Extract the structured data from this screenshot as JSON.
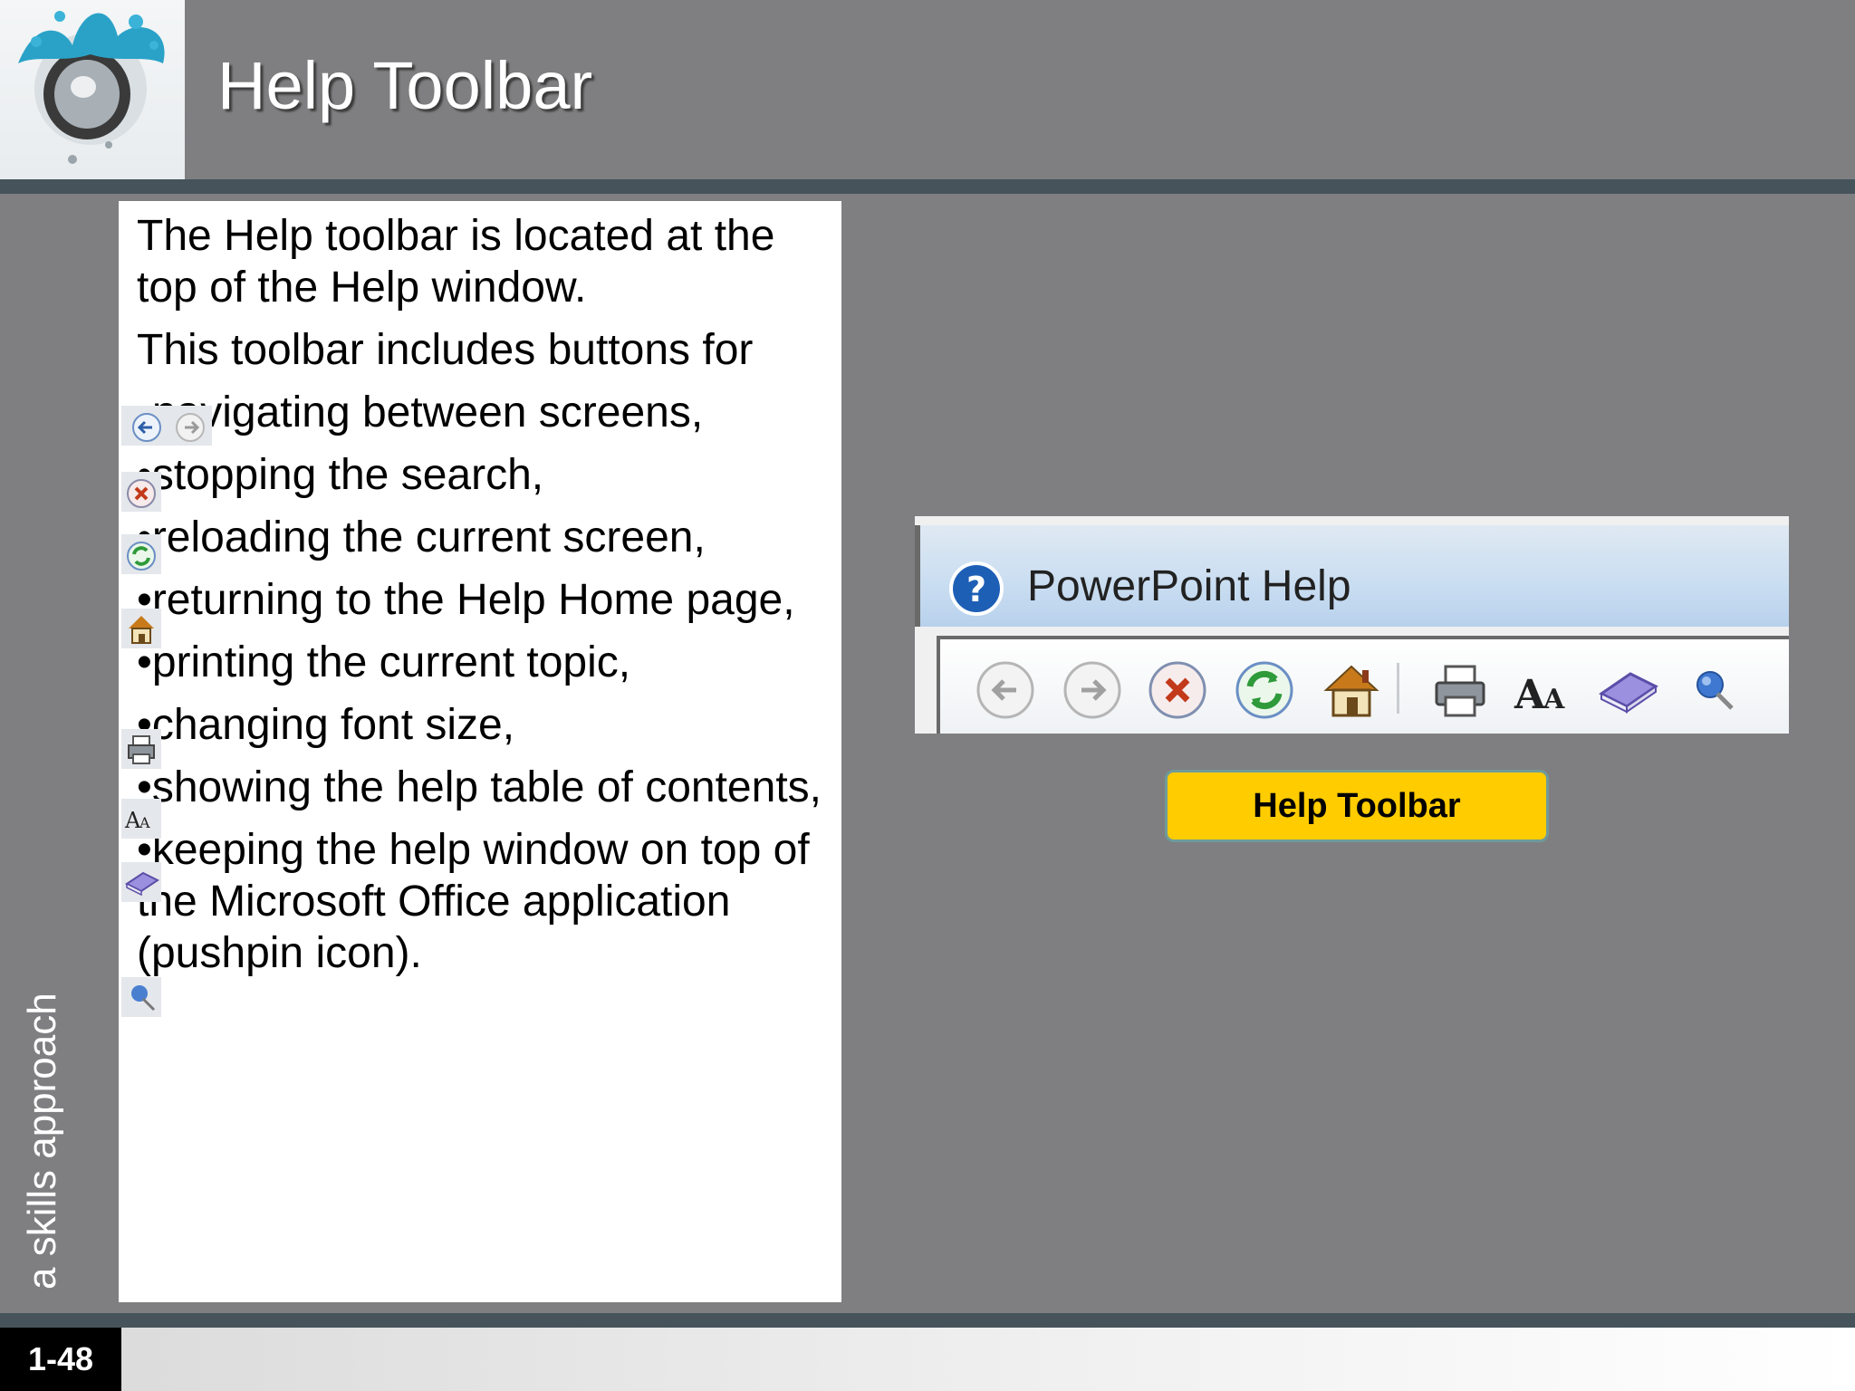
{
  "slide": {
    "title": "Help Toolbar",
    "side_label": "a skills approach",
    "slide_number": "1-48"
  },
  "content": {
    "para1": "The Help toolbar is located at the top of the Help window.",
    "para2": "This toolbar includes buttons for",
    "bullets": [
      "navigating between screens,",
      "stopping the search,",
      "reloading the current screen,",
      "returning to the Help Home page,",
      "printing the current topic,",
      "changing font size,",
      "showing the help table of contents,",
      "keeping the help window on top of the Microsoft Office application (pushpin icon)."
    ]
  },
  "screenshot": {
    "window_title": "PowerPoint Help",
    "toolbar_icons": [
      "back-icon",
      "forward-icon",
      "stop-icon",
      "refresh-icon",
      "home-icon",
      "print-icon",
      "font-size-icon",
      "table-of-contents-icon",
      "pushpin-icon"
    ]
  },
  "caption": "Help Toolbar",
  "colors": {
    "background": "#7f7f81",
    "band": "#46535a",
    "caption_fill": "#ffcc00"
  }
}
